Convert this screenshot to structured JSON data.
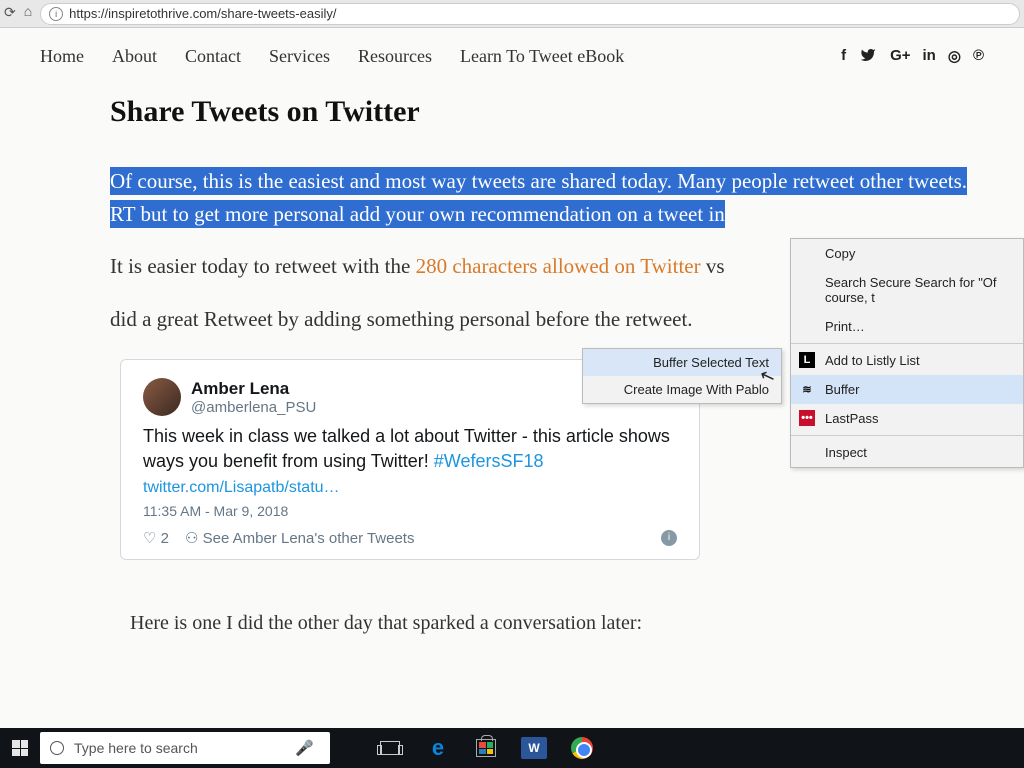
{
  "browser": {
    "url": "https://inspiretothrive.com/share-tweets-easily/"
  },
  "nav": {
    "items": [
      "Home",
      "About",
      "Contact",
      "Services",
      "Resources",
      "Learn To Tweet eBook"
    ],
    "social": [
      "f",
      "",
      "G+",
      "in",
      "◎",
      "℗"
    ]
  },
  "article": {
    "title": "Share Tweets on Twitter",
    "highlight_line1": "Of course, this is the easiest and most way tweets are shared today. Many people retweet other tweets.",
    "highlight_line2_a": "RT but to get more personal add your own recommendation on a tweet in",
    "para2_a": "It is easier today to retweet with the ",
    "para2_link": "280 characters allowed on Twitter",
    "para2_b": " vs",
    "para3": "did a great Retweet by adding something personal before the retweet.",
    "below": "Here is one I did the other day that sparked a conversation later:"
  },
  "tweet": {
    "name": "Amber Lena",
    "handle": "@amberlena_PSU",
    "text_a": "This week in class we talked a lot about Twitter - this article shows ways you benefit from using Twitter! ",
    "hashtag": "#WefersSF18",
    "link": "twitter.com/Lisapatb/statu…",
    "time": "11:35 AM - Mar 9, 2018",
    "likes": "2",
    "see_more": "See Amber Lena's other Tweets"
  },
  "context_menu": {
    "copy": "Copy",
    "search": "Search Secure Search for \"Of course, t",
    "print": "Print…",
    "listly": "Add to Listly List",
    "buffer": "Buffer",
    "lastpass": "LastPass",
    "inspect": "Inspect"
  },
  "sub_menu": {
    "buffer_selected": "Buffer Selected Text",
    "pablo": "Create Image With Pablo"
  },
  "taskbar": {
    "search_placeholder": "Type here to search"
  }
}
